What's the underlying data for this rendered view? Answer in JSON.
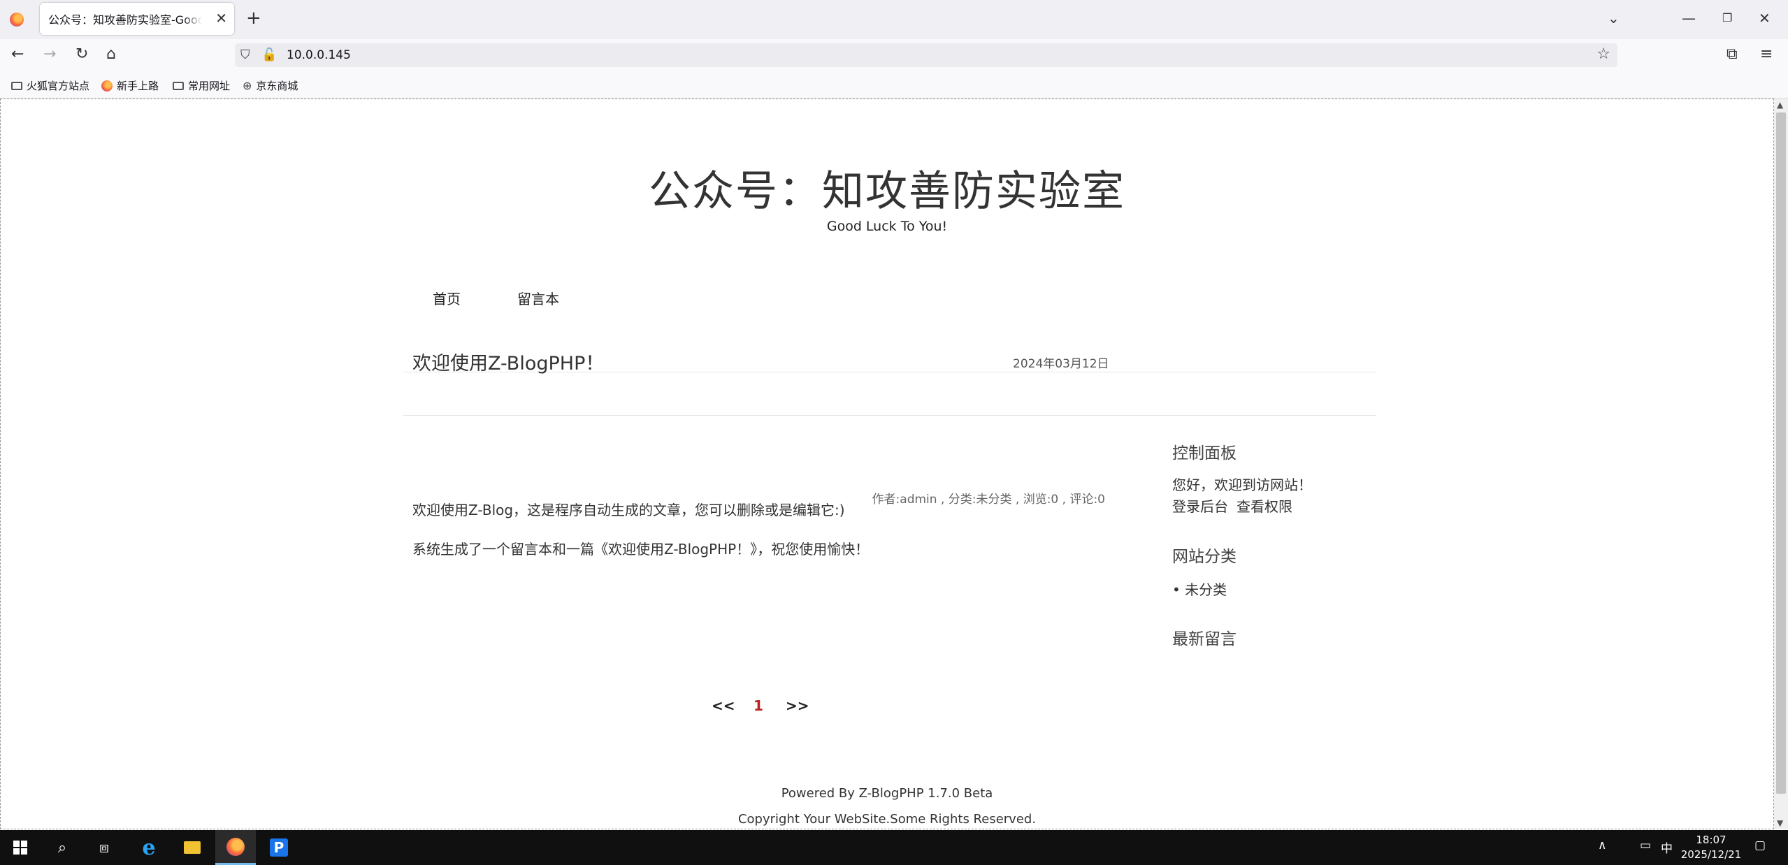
{
  "browser": {
    "tab_title": "公众号：知攻善防实验室-Good Luck To You!",
    "url": "10.0.0.145",
    "bookmarks": [
      "火狐官方站点",
      "新手上路",
      "常用网址",
      "京东商城"
    ]
  },
  "site": {
    "title": "公众号：知攻善防实验室",
    "subtitle": "Good Luck To You!",
    "nav": [
      "首页",
      "留言本"
    ]
  },
  "post": {
    "title": "欢迎使用Z-BlogPHP！",
    "date": "2024年03月12日",
    "para1": "欢迎使用Z-Blog，这是程序自动生成的文章，您可以删除或是编辑它:)",
    "para2": "系统生成了一个留言本和一篇《欢迎使用Z-BlogPHP！》，祝您使用愉快！",
    "meta": "作者:admin , 分类:未分类 , 浏览:0 , 评论:0"
  },
  "sidebar": {
    "control_title": "控制面板",
    "welcome": "您好，欢迎到访网站！",
    "login_link": "登录后台",
    "perm_link": "查看权限",
    "category_title": "网站分类",
    "category_item": "• 未分类",
    "comments_title": "最新留言"
  },
  "pager": {
    "prev": "<<",
    "current": "1",
    "next": ">>"
  },
  "footer": {
    "powered": "Powered By Z-BlogPHP 1.7.0 Beta",
    "copyright": "Copyright Your WebSite.Some Rights Reserved."
  },
  "taskbar": {
    "ime": "中",
    "time": "18:07",
    "date": "2025/12/21"
  },
  "icons": {
    "colors": {
      "accent_pager": "#b22222",
      "taskbar_bg": "#101010",
      "chrome_bg": "#f0f0f4"
    }
  }
}
